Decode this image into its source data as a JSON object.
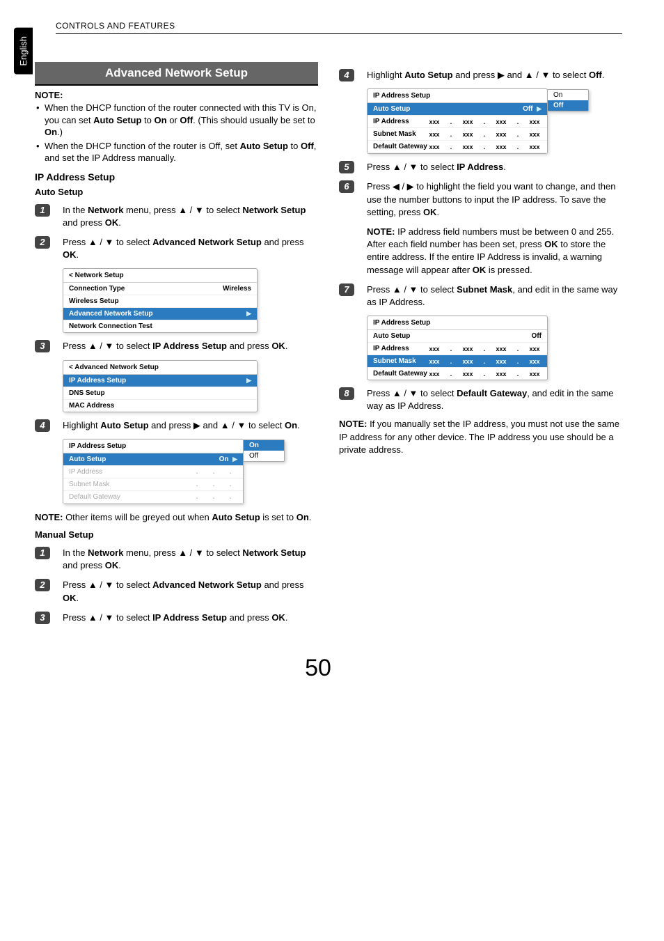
{
  "header": "CONTROLS AND FEATURES",
  "lang_tab": "English",
  "page_number": "50",
  "section_title": "Advanced Network Setup",
  "note_label": "NOTE:",
  "notes": {
    "n1a": "When the DHCP function of the router connected with this TV is On, you can set ",
    "n1b": "Auto Setup",
    "n1c": " to ",
    "n1d": "On",
    "n1e": " or ",
    "n1f": "Off",
    "n1g": ". (This should usually be set to ",
    "n1h": "On",
    "n1i": ".)",
    "n2a": "When the DHCP function of the router is Off, set ",
    "n2b": "Auto Setup",
    "n2c": " to ",
    "n2d": "Off",
    "n2e": ", and set the IP Address manually."
  },
  "h_ip_setup": "IP Address Setup",
  "h_auto": "Auto Setup",
  "h_manual": "Manual Setup",
  "auto": {
    "s1a": "In the ",
    "s1b": "Network",
    "s1c": " menu, press ▲ / ▼ to select ",
    "s1d": "Network Setup",
    "s1e": " and press ",
    "s1f": "OK",
    "s1g": ".",
    "s2a": "Press ▲ / ▼ to select ",
    "s2b": "Advanced Network Setup",
    "s2c": " and press ",
    "s2d": "OK",
    "s2e": ".",
    "s3a": "Press ▲ / ▼ to select ",
    "s3b": "IP Address Setup",
    "s3c": " and press ",
    "s3d": "OK",
    "s3e": ".",
    "s4a": "Highlight ",
    "s4b": "Auto Setup",
    "s4c": " and press ▶ and ▲ / ▼ to select ",
    "s4d": "On",
    "s4e": "."
  },
  "auto_note_a": "NOTE:",
  "auto_note_b": " Other items will be greyed out when ",
  "auto_note_c": "Auto Setup",
  "auto_note_d": " is set to ",
  "auto_note_e": "On",
  "auto_note_f": ".",
  "manual": {
    "s1a": "In the ",
    "s1b": "Network",
    "s1c": " menu, press ▲ / ▼ to select ",
    "s1d": "Network Setup",
    "s1e": " and press ",
    "s1f": "OK",
    "s1g": ".",
    "s2a": "Press ▲ / ▼ to select ",
    "s2b": "Advanced Network Setup",
    "s2c": " and press ",
    "s2d": "OK",
    "s2e": ".",
    "s3a": "Press ▲ / ▼ to select ",
    "s3b": "IP Address Setup",
    "s3c": " and press ",
    "s3d": "OK",
    "s3e": ".",
    "s4a": "Highlight ",
    "s4b": "Auto Setup",
    "s4c": " and press ▶ and ▲ / ▼ to select ",
    "s4d": "Off",
    "s4e": ".",
    "s5a": "Press ▲ / ▼ to select ",
    "s5b": "IP Address",
    "s5c": ".",
    "s6a": "Press ◀ / ▶ to highlight the field you want to change, and then use the number buttons to input the IP address. To save the setting, press ",
    "s6b": "OK",
    "s6c": ".",
    "s6_note_a": "NOTE:",
    "s6_note_b": " IP address field numbers must be between 0 and 255. After each field number has been set, press ",
    "s6_note_c": "OK",
    "s6_note_d": " to store the entire address. If the entire IP Address is invalid, a warning message will appear after ",
    "s6_note_e": "OK",
    "s6_note_f": " is pressed.",
    "s7a": "Press ▲ / ▼ to select ",
    "s7b": "Subnet Mask",
    "s7c": ", and edit in the same way as IP Address.",
    "s8a": "Press ▲ / ▼ to select ",
    "s8b": "Default Gateway",
    "s8c": ", and edit in the same way as IP Address."
  },
  "final_note_a": "NOTE:",
  "final_note_b": " If you manually set the IP address, you must not use the same IP address for any other device. The IP address you use should be a private address.",
  "ui1": {
    "title": "< Network Setup",
    "r1": "Connection Type",
    "r1v": "Wireless",
    "r2": "Wireless Setup",
    "r3": "Advanced Network Setup",
    "r4": "Network Connection Test"
  },
  "ui2": {
    "title": "< Advanced Network Setup",
    "r1": "IP Address Setup",
    "r2": "DNS Setup",
    "r3": "MAC Address"
  },
  "ui3": {
    "title": "IP Address Setup",
    "r1": "Auto Setup",
    "r1v": "On",
    "r2": "IP Address",
    "r3": "Subnet Mask",
    "r4": "Default Gateway",
    "fly1": "On",
    "fly2": "Off"
  },
  "ui4": {
    "title": "IP Address Setup",
    "r1": "Auto Setup",
    "r1v": "Off",
    "r2": "IP Address",
    "v": "xxx",
    "dot": ". ",
    "r3": "Subnet Mask",
    "r4": "Default Gateway",
    "fly1": "On",
    "fly2": "Off"
  },
  "ui5": {
    "title": "IP Address Setup",
    "r1": "Auto Setup",
    "r1v": "Off",
    "r2": "IP Address",
    "r3": "Subnet Mask",
    "r4": "Default Gateway",
    "v": "xxx",
    "dot": ". "
  }
}
